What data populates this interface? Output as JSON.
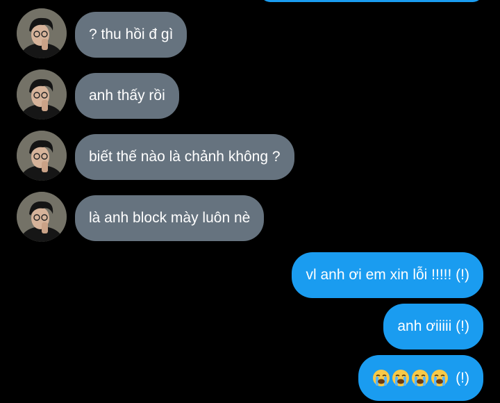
{
  "conversation": {
    "incoming": [
      {
        "text": "? thu hồi đ gì"
      },
      {
        "text": "anh thấy rồi"
      },
      {
        "text": "biết thế nào là chảnh không ?"
      },
      {
        "text": "là anh block mày luôn nè"
      }
    ],
    "outgoing": [
      {
        "text": "vl anh ơi em xin lỗi !!!!! (!)"
      },
      {
        "text": "anh ơiiiii (!)"
      },
      {
        "text": "(!)",
        "emoji": "loudly-crying-face-icon",
        "emoji_count": 4
      }
    ]
  },
  "colors": {
    "background": "#000000",
    "incoming_bubble": "#66737f",
    "outgoing_bubble": "#1a9cf0",
    "text": "#ffffff"
  }
}
